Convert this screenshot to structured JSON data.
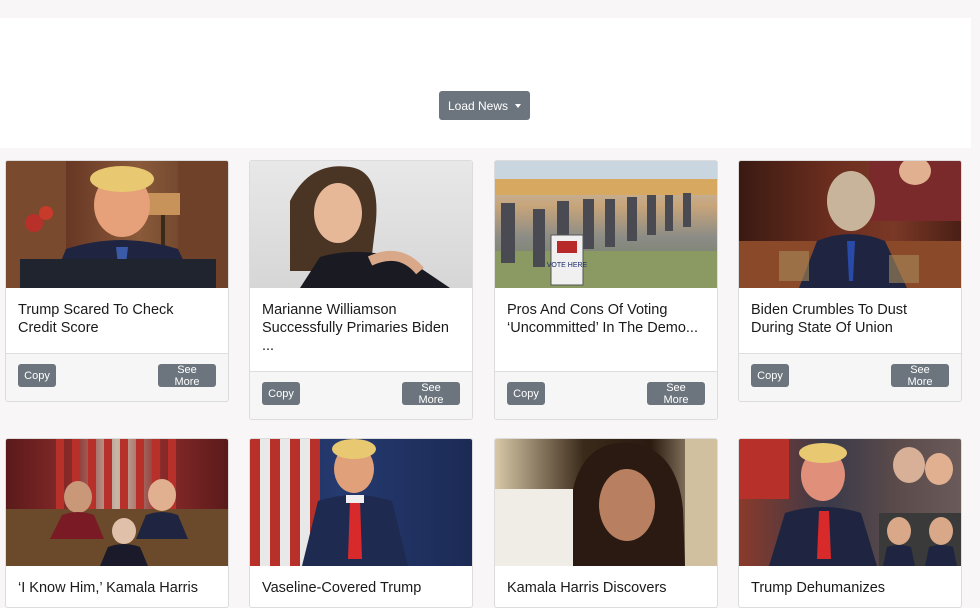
{
  "header": {
    "load_news_label": "Load News"
  },
  "cards": [
    {
      "title": "Trump Scared To Check Credit Score",
      "image": "trump-desk-photo",
      "copy_label": "Copy",
      "more_label": "See More"
    },
    {
      "title": "Marianne Williamson Successfully Primaries Biden ...",
      "image": "marianne-williamson-photo",
      "copy_label": "Copy",
      "more_label": "See More"
    },
    {
      "title": "Pros And Cons Of Voting ‘Uncommitted’ In The Demo...",
      "image": "voting-line-photo",
      "copy_label": "Copy",
      "more_label": "See More"
    },
    {
      "title": "Biden Crumbles To Dust During State Of Union",
      "image": "biden-crumbling-photo",
      "copy_label": "Copy",
      "more_label": "See More"
    },
    {
      "title": "‘I Know Him,’ Kamala Harris",
      "image": "state-of-union-photo"
    },
    {
      "title": "Vaseline-Covered Trump",
      "image": "trump-flags-photo"
    },
    {
      "title": "Kamala Harris Discovers",
      "image": "kamala-harris-photo"
    },
    {
      "title": "Trump Dehumanizes",
      "image": "trump-rally-photo"
    }
  ],
  "vote_sign": "VOTE HERE",
  "colors": {
    "button": "#6c757d",
    "page_bg": "#f8f6f6",
    "card_bg": "#ffffff"
  }
}
